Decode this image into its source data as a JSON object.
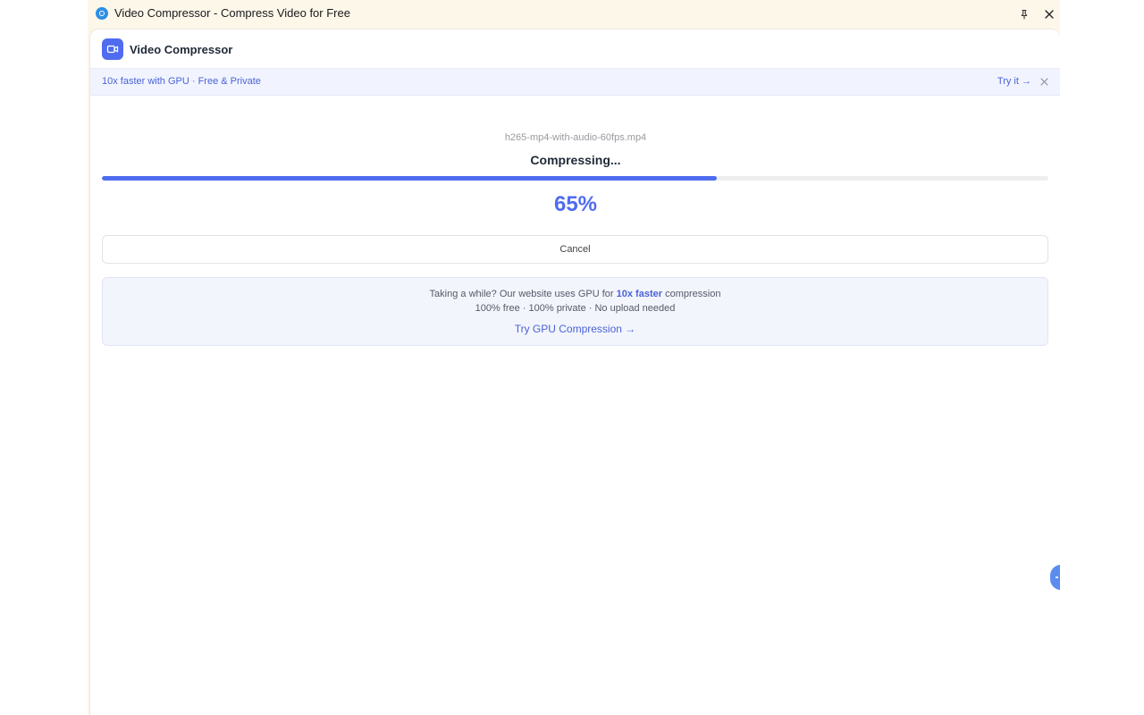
{
  "window": {
    "title": "Video Compressor - Compress Video for Free"
  },
  "app": {
    "name": "Video Compressor"
  },
  "promo": {
    "text": "10x faster with GPU · Free & Private",
    "try_label": "Try it →"
  },
  "compression": {
    "filename": "h265-mp4-with-audio-60fps.mp4",
    "status": "Compressing...",
    "progress_percent": 65,
    "percent_label": "65%",
    "cancel_label": "Cancel"
  },
  "gpu_card": {
    "line1_prefix": "Taking a while? Our website uses GPU for ",
    "line1_highlight": "10x faster",
    "line1_suffix": " compression",
    "line2": "100% free · 100% private · No upload needed",
    "link_label": "Try GPU Compression →"
  },
  "colors": {
    "accent": "#4f6cf0",
    "titlebar_bg": "#fdf7ea",
    "promo_bg": "#f1f4fe"
  },
  "icons": {
    "app": "chrome-app-icon",
    "pin": "pin-icon",
    "close": "close-icon",
    "logo": "video-camera-icon",
    "promo_close": "close-icon"
  }
}
